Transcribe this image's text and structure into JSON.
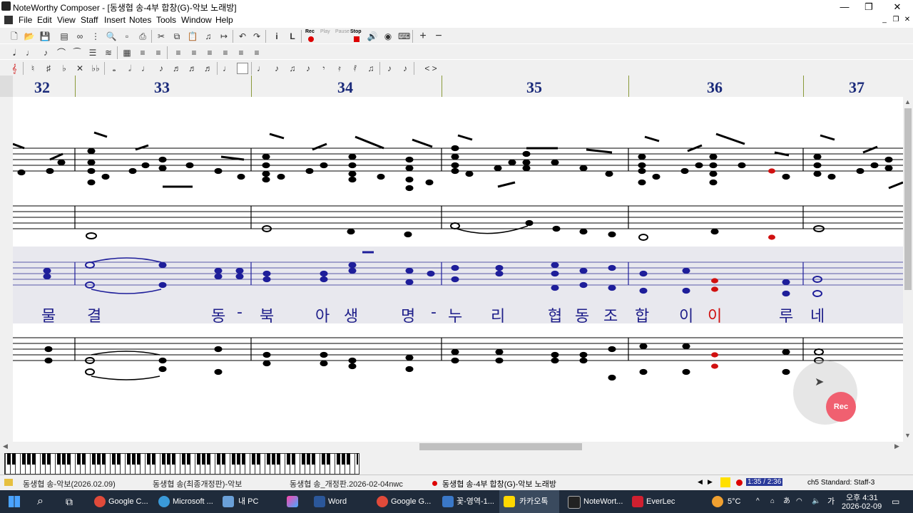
{
  "window": {
    "title": "NoteWorthy Composer - [동생협 송-4부 합창(G)-악보 노래방]",
    "buttons": {
      "minimize": "—",
      "maximize": "❐",
      "close": "✕"
    }
  },
  "menu": [
    "File",
    "Edit",
    "View",
    "Staff",
    "Insert",
    "Notes",
    "Tools",
    "Window",
    "Help"
  ],
  "toolbar": {
    "play_labels": [
      "Rec",
      "Play",
      "Pause",
      "Stop"
    ]
  },
  "measures": [
    "32",
    "33",
    "34",
    "35",
    "36",
    "37"
  ],
  "lyrics": [
    "물",
    "결",
    "동",
    "-",
    "북",
    "아",
    "생",
    "명",
    "-",
    "누",
    "리",
    "협",
    "동",
    "조",
    "합",
    "이",
    "이",
    "루",
    "네"
  ],
  "lyric_highlight_index": 16,
  "rec_overlay": {
    "label": "Rec"
  },
  "pages": [
    "동생협 송-악보(2026.02.09)",
    "동생협 송(최종개정판)-악보",
    "동생협 송_개정판.2026-02-04nwc",
    "동생협 송-4부 합창(G)-악보 노래방"
  ],
  "status": {
    "time": "1:35 / 2:36",
    "staff": "ch5 Standard: Staff-3"
  },
  "taskbar": {
    "apps": [
      "Google C...",
      "Microsoft ...",
      "내 PC",
      "",
      "Word",
      "Google G...",
      "꽃-영역-1...",
      "카카오톡",
      "NoteWort...",
      "EverLec"
    ],
    "weather": "5°C",
    "ime": "가",
    "clock_time": "오후 4:31",
    "clock_date": "2026-02-09"
  },
  "colors": {
    "active_staff": "#1e1e9a",
    "highlight_note": "#d01010",
    "measure_number": "#1a2a7a",
    "rec_button": "#f06070",
    "taskbar": "#1f2b3b"
  }
}
